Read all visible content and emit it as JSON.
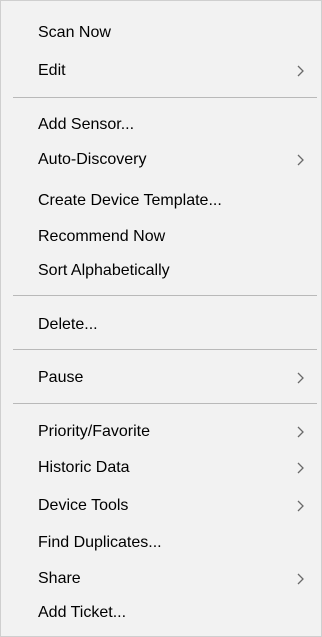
{
  "menu": {
    "items": [
      {
        "label": "Scan Now",
        "submenu": false
      },
      {
        "label": "Edit",
        "submenu": true
      },
      {
        "label": "Add Sensor...",
        "submenu": false
      },
      {
        "label": "Auto-Discovery",
        "submenu": true
      },
      {
        "label": "Create Device Template...",
        "submenu": false
      },
      {
        "label": "Recommend Now",
        "submenu": false
      },
      {
        "label": "Sort Alphabetically",
        "submenu": false
      },
      {
        "label": "Delete...",
        "submenu": false
      },
      {
        "label": "Pause",
        "submenu": true
      },
      {
        "label": "Priority/Favorite",
        "submenu": true
      },
      {
        "label": "Historic Data",
        "submenu": true
      },
      {
        "label": "Device Tools",
        "submenu": true
      },
      {
        "label": "Find Duplicates...",
        "submenu": false
      },
      {
        "label": "Share",
        "submenu": true
      },
      {
        "label": "Add Ticket...",
        "submenu": false
      }
    ],
    "chevron_icon": "chevron-right-icon",
    "colors": {
      "background": "#f2f2f2",
      "text": "#000000",
      "separator": "#b9b9b9",
      "chevron": "#6a6a6a"
    }
  }
}
